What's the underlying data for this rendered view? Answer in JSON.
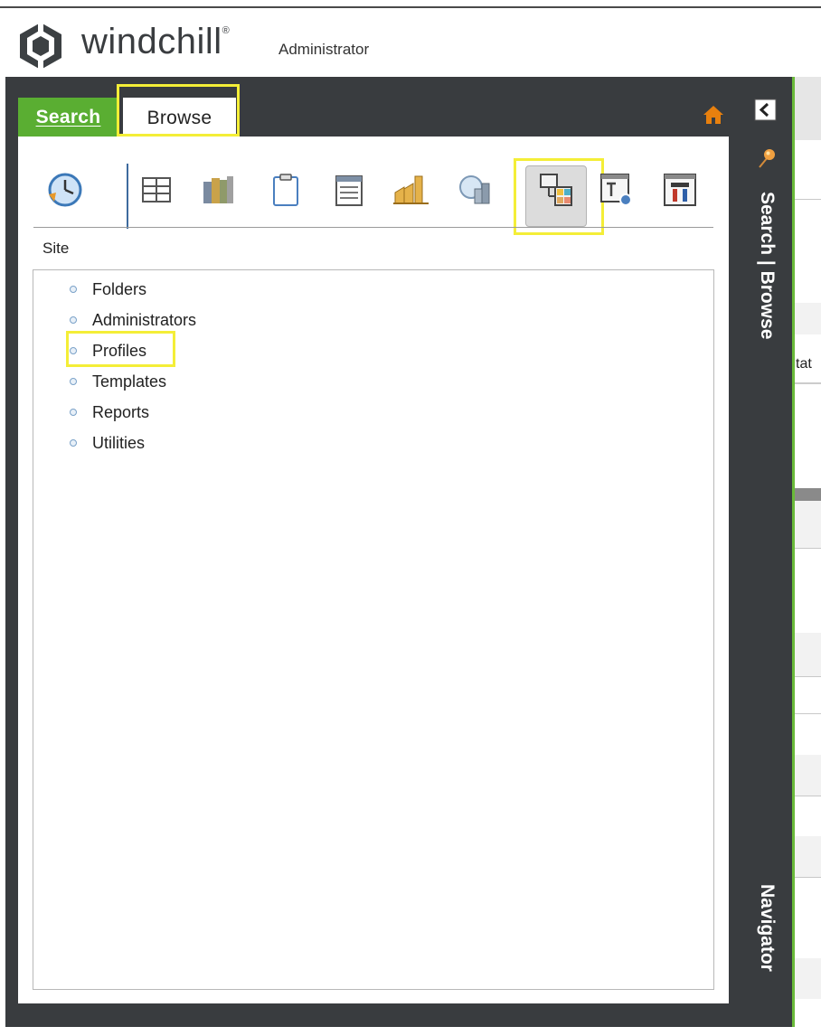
{
  "header": {
    "app_name": "windchill",
    "trademark": "®",
    "user_role": "Administrator"
  },
  "navigator": {
    "tabs": [
      {
        "label": "Search",
        "active": false
      },
      {
        "label": "Browse",
        "active": true
      }
    ],
    "vertical_labels": {
      "search_browse": "Search | Browse",
      "navigator": "Navigator"
    },
    "toolbar": {
      "icons": [
        "recent-icon",
        "products-icon",
        "libraries-icon",
        "projects-icon",
        "change-notices-icon",
        "factories-icon",
        "quality-icon",
        "organizations-icon",
        "site-icon",
        "utilities-icon"
      ],
      "selected_icon": "organizations-icon"
    },
    "context_label": "Site",
    "tree_items": [
      {
        "label": "Folders"
      },
      {
        "label": "Administrators"
      },
      {
        "label": "Profiles"
      },
      {
        "label": "Templates"
      },
      {
        "label": "Reports"
      },
      {
        "label": "Utilities"
      }
    ]
  },
  "right_area": {
    "cut_text": "tat"
  },
  "colors": {
    "panel_dark": "#393c3f",
    "accent_green": "#5aae32",
    "highlight_yellow": "#f4ee37",
    "home_orange": "#e8800e"
  }
}
